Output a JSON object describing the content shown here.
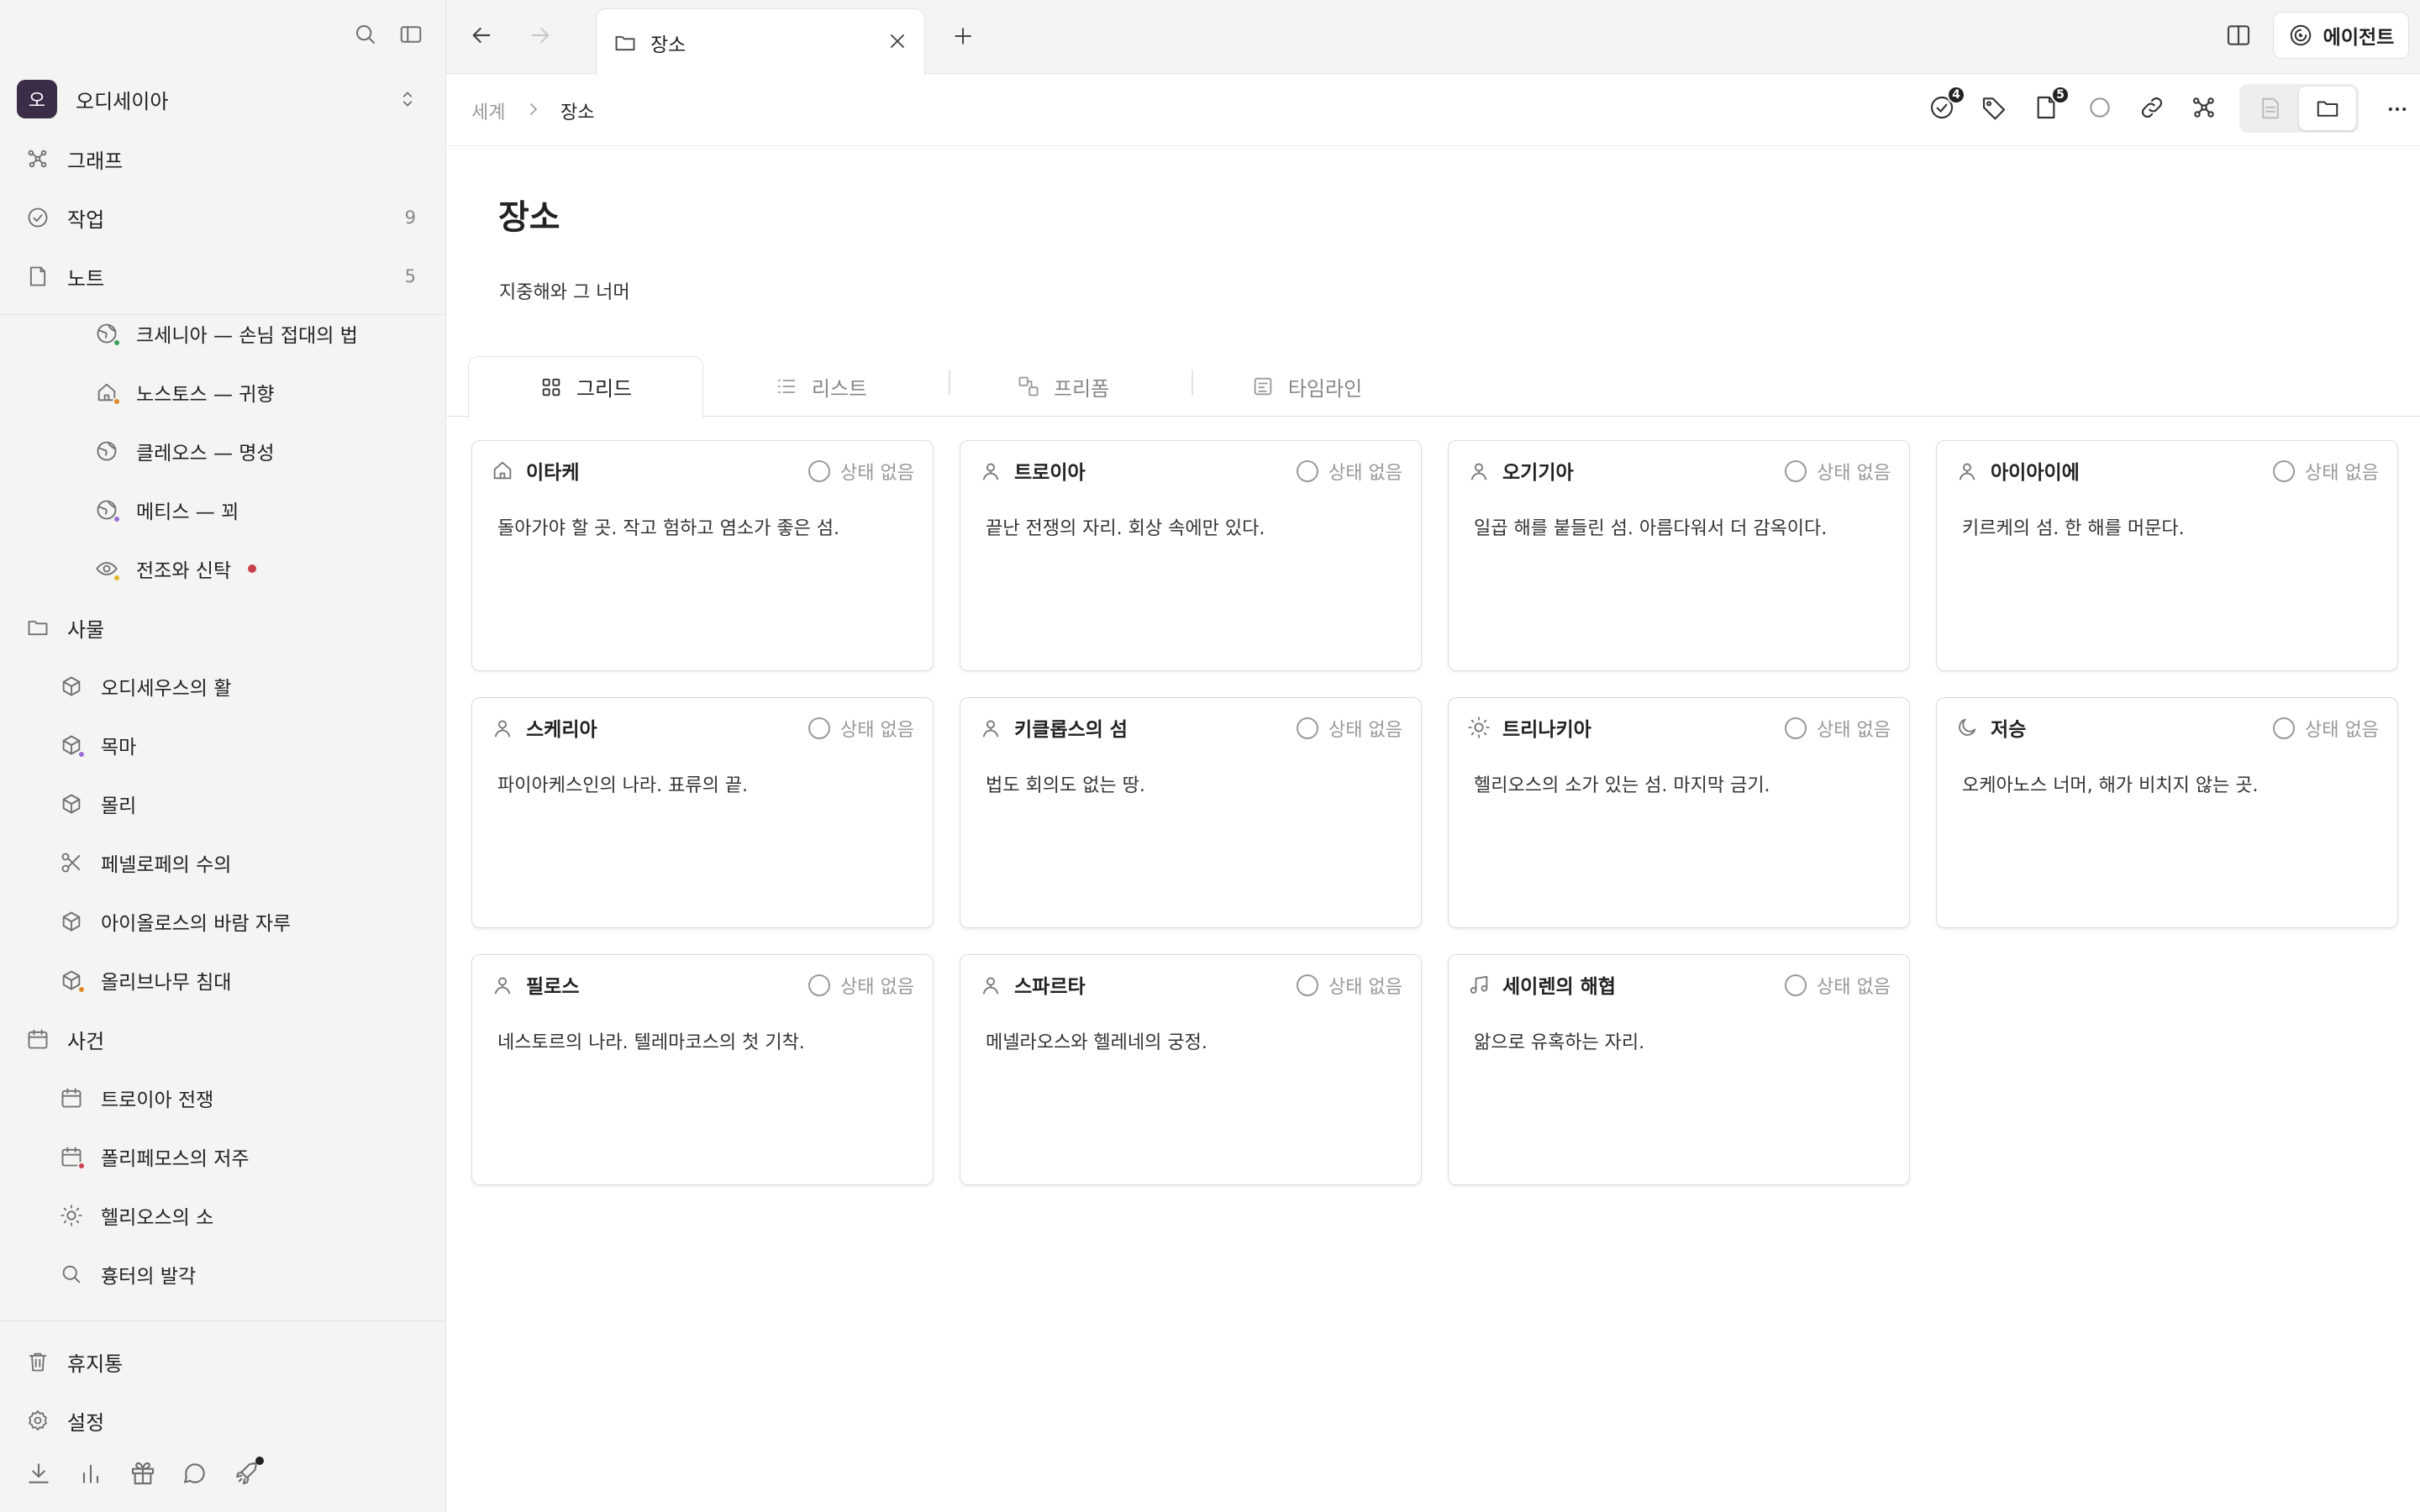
{
  "workspace": {
    "avatar": "오",
    "name": "오디세이아"
  },
  "sidebar": {
    "nav": [
      {
        "label": "그래프",
        "count": ""
      },
      {
        "label": "작업",
        "count": "9"
      },
      {
        "label": "노트",
        "count": "5"
      }
    ],
    "places": [
      {
        "label": "크세니아 — 손님 접대의 법",
        "dot": "#3aa35a"
      },
      {
        "label": "노스토스 — 귀향",
        "dot": "#e0892b"
      },
      {
        "label": "클레오스 — 명성",
        "dot": ""
      },
      {
        "label": "메티스 — 꾀",
        "dot": "#9b6dd6"
      },
      {
        "label": "전조와 신탁",
        "dot": "#e3b72a"
      }
    ],
    "things_header": "사물",
    "things": [
      {
        "label": "오디세우스의 활",
        "dot": ""
      },
      {
        "label": "목마",
        "dot": "#9b6dd6"
      },
      {
        "label": "몰리",
        "dot": ""
      },
      {
        "label": "페넬로페의 수의",
        "dot": ""
      },
      {
        "label": "아이올로스의 바람 자루",
        "dot": ""
      },
      {
        "label": "올리브나무 침대",
        "dot": "#e0892b"
      }
    ],
    "events_header": "사건",
    "events": [
      {
        "label": "트로이아 전쟁",
        "dot": ""
      },
      {
        "label": "폴리페모스의 저주",
        "dot": "#c9414d"
      },
      {
        "label": "헬리오스의 소",
        "dot": ""
      },
      {
        "label": "흉터의 발각",
        "dot": ""
      }
    ],
    "trash": "휴지통",
    "settings": "설정"
  },
  "tab": {
    "label": "장소"
  },
  "agent_label": "에이전트",
  "breadcrumb": {
    "parent": "세계",
    "current": "장소"
  },
  "toolbar": {
    "tasks_badge": "4",
    "notes_badge": "5"
  },
  "page": {
    "title": "장소",
    "description": "지중해와 그 너머"
  },
  "views": {
    "grid": "그리드",
    "list": "리스트",
    "freeform": "프리폼",
    "timeline": "타임라인"
  },
  "status_empty": "상태 없음",
  "cards": [
    {
      "name": "이타케",
      "icon": "home-icon",
      "desc": "돌아가야 할 곳. 작고 험하고 염소가 좋은 섬."
    },
    {
      "name": "트로이아",
      "icon": "location-icon",
      "desc": "끝난 전쟁의 자리. 회상 속에만 있다."
    },
    {
      "name": "오기기아",
      "icon": "location-icon",
      "desc": "일곱 해를 붙들린 섬. 아름다워서 더 감옥이다."
    },
    {
      "name": "아이아이에",
      "icon": "location-icon",
      "desc": "키르케의 섬. 한 해를 머문다."
    },
    {
      "name": "스케리아",
      "icon": "location-icon",
      "desc": "파이아케스인의 나라. 표류의 끝."
    },
    {
      "name": "키클롭스의 섬",
      "icon": "location-icon",
      "desc": "법도 회의도 없는 땅."
    },
    {
      "name": "트리나키아",
      "icon": "sun-icon",
      "desc": "헬리오스의 소가 있는 섬. 마지막 금기."
    },
    {
      "name": "저승",
      "icon": "moon-icon",
      "desc": "오케아노스 너머, 해가 비치지 않는 곳."
    },
    {
      "name": "필로스",
      "icon": "location-icon",
      "desc": "네스토르의 나라. 텔레마코스의 첫 기착."
    },
    {
      "name": "스파르타",
      "icon": "location-icon",
      "desc": "메넬라오스와 헬레네의 궁정."
    },
    {
      "name": "세이렌의 해협",
      "icon": "music-icon",
      "desc": "앎으로 유혹하는 자리."
    }
  ]
}
